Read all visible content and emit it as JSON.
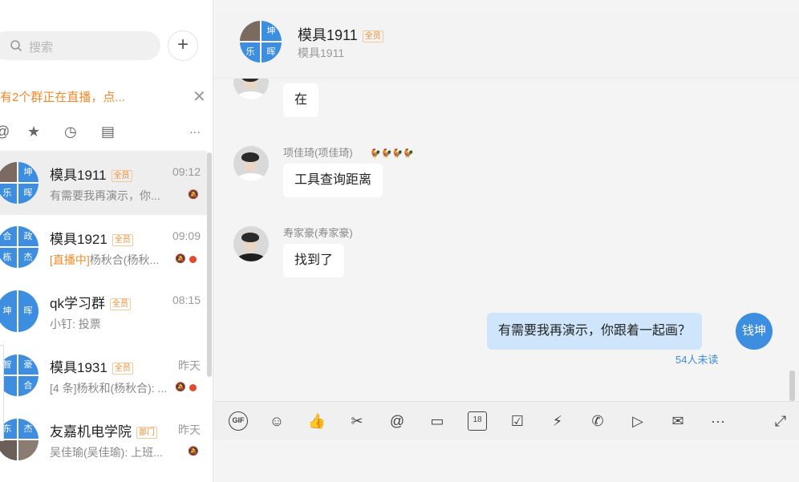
{
  "search": {
    "placeholder": "搜索",
    "add_label": "+"
  },
  "live_banner": {
    "text": "有2个群正在直播，点...",
    "close": "✕"
  },
  "tabs": [
    {
      "icon": "at-icon",
      "glyph": "@"
    },
    {
      "icon": "star-icon",
      "glyph": "★"
    },
    {
      "icon": "clock-icon",
      "glyph": "◷"
    },
    {
      "icon": "archive-icon",
      "glyph": "▤"
    },
    {
      "icon": "more-icon",
      "glyph": "···"
    }
  ],
  "conversations": [
    {
      "name": "模具1911",
      "badge": "全员",
      "time": "09:12",
      "preview": "有需要我再演示，你...",
      "preview_tag": "",
      "avatar": [
        "",
        "坤",
        "乐",
        "晖"
      ]
    },
    {
      "name": "模具1921",
      "badge": "全员",
      "time": "09:09",
      "preview": "杨秋合(杨秋...",
      "preview_tag": "[直播中]",
      "avatar": [
        "合",
        "政",
        "栋",
        "杰"
      ]
    },
    {
      "name": "qk学习群",
      "badge": "全员",
      "time": "08:15",
      "preview": "小钉: 投票",
      "preview_tag": "",
      "avatar": [
        "坤",
        "晖",
        "",
        ""
      ]
    },
    {
      "name": "模具1931",
      "badge": "全员",
      "time": "昨天",
      "preview": "[4 条]杨秋和(杨秋合): ...",
      "preview_tag": "",
      "avatar": [
        "智",
        "豪",
        "",
        "合"
      ]
    },
    {
      "name": "友嘉机电学院",
      "badge": "部门",
      "time": "昨天",
      "preview": "吴佳瑜(吴佳瑜): 上班...",
      "preview_tag": "",
      "avatar": [
        "东",
        "杰",
        "",
        ""
      ]
    }
  ],
  "chat_header": {
    "title": "模具1911",
    "badge": "全员",
    "subtitle": "模具1911",
    "avatar": [
      "",
      "坤",
      "乐",
      "晖"
    ]
  },
  "messages": [
    {
      "sender": "",
      "text": "在"
    },
    {
      "sender": "项佳琦(项佳琦)",
      "text": "工具查询距离",
      "emoji": "🐓🐓🐓🐓"
    },
    {
      "sender": "寿家豪(寿家豪)",
      "text": "找到了"
    }
  ],
  "my_message": {
    "text": "有需要我再演示，你跟着一起画？",
    "avatar_label": "钱坤",
    "unread": "54人未读"
  },
  "toolbar": {
    "gif": "GIF",
    "emoji": "☺",
    "like": "👍",
    "scissors": "✂",
    "at": "@",
    "folder": "▭",
    "calendar": "18",
    "check": "☑",
    "flash": "⚡",
    "phone": "✆",
    "live": "▷",
    "mail": "✉",
    "more": "···",
    "expand": "⤢"
  }
}
